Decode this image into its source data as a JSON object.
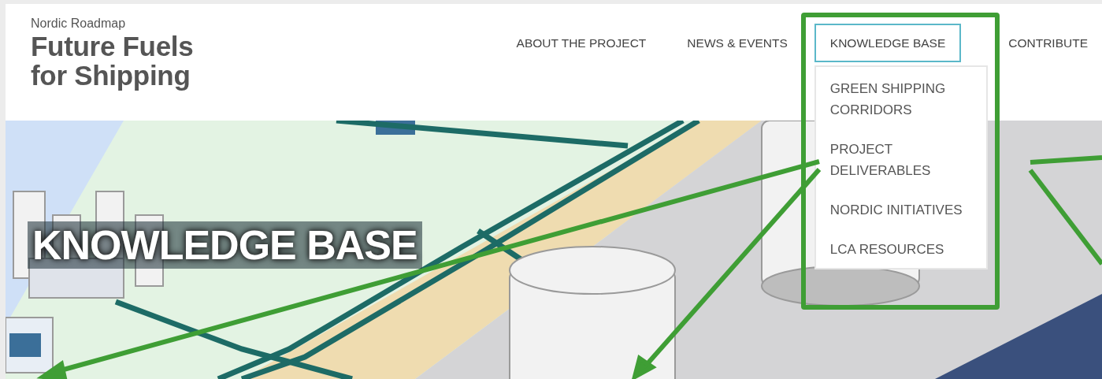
{
  "logo": {
    "overline": "Nordic Roadmap",
    "title_lines": [
      "Future Fuels",
      "for Shipping"
    ]
  },
  "nav": [
    {
      "label": "ABOUT THE PROJECT",
      "selected": false
    },
    {
      "label": "NEWS & EVENTS",
      "selected": false
    },
    {
      "label": "KNOWLEDGE BASE",
      "selected": true,
      "expanded": true,
      "children": [
        {
          "label": "GREEN SHIPPING CORRIDORS"
        },
        {
          "label": "PROJECT DELIVERABLES"
        },
        {
          "label": "NORDIC INITIATIVES"
        },
        {
          "label": "LCA RESOURCES"
        }
      ]
    },
    {
      "label": "CONTRIBUTE",
      "selected": false
    }
  ],
  "hero": {
    "title": "KNOWLEDGE BASE"
  }
}
